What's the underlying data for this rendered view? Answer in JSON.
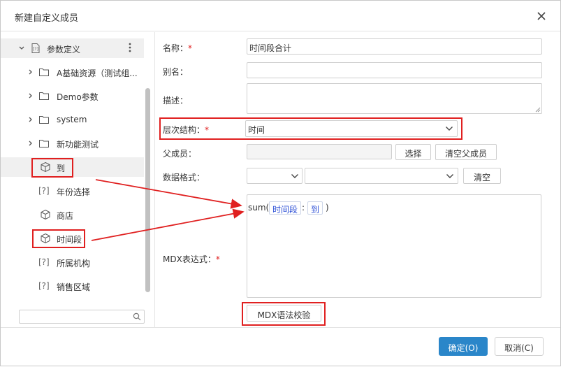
{
  "dialog": {
    "title": "新建自定义成员",
    "close_icon": "close-icon"
  },
  "tree": {
    "root_label": "参数定义",
    "items": [
      {
        "label": "A基础资源（测试组...",
        "icon": "folder-icon"
      },
      {
        "label": "Demo参数",
        "icon": "folder-icon"
      },
      {
        "label": "system",
        "icon": "folder-icon"
      },
      {
        "label": "新功能测试",
        "icon": "folder-icon"
      },
      {
        "label": "到",
        "icon": "cube-icon"
      },
      {
        "label": "年份选择",
        "icon": "param-icon"
      },
      {
        "label": "商店",
        "icon": "cube-icon"
      },
      {
        "label": "时间段",
        "icon": "cube-icon"
      },
      {
        "label": "所属机构",
        "icon": "param-icon"
      },
      {
        "label": "销售区域",
        "icon": "param-icon"
      }
    ],
    "param_glyph": "[?]",
    "search_value": ""
  },
  "form": {
    "name_label": "名称：",
    "name_value": "时间段合计",
    "alias_label": "别名：",
    "alias_value": "",
    "desc_label": "描述：",
    "desc_value": "",
    "hierarchy_label": "层次结构：",
    "hierarchy_value": "时间",
    "parent_label": "父成员：",
    "parent_value": "",
    "select_btn": "选择",
    "clear_parent_btn": "清空父成员",
    "format_label": "数据格式：",
    "format_value_1": "",
    "format_value_2": "",
    "clear_btn": "清空",
    "mdx_label": "MDX表达式：",
    "required_mark": "*",
    "mdx_prefix": "sum(",
    "mdx_token_1": "时间段",
    "mdx_sep": ":",
    "mdx_token_2": "到",
    "mdx_suffix": ")",
    "validate_btn": "MDX语法校验"
  },
  "footer": {
    "ok_btn": "确定(O)",
    "cancel_btn": "取消(C)"
  },
  "colors": {
    "accent": "#2a86c9",
    "annotation": "#e02020",
    "token": "#2c4fd6"
  }
}
